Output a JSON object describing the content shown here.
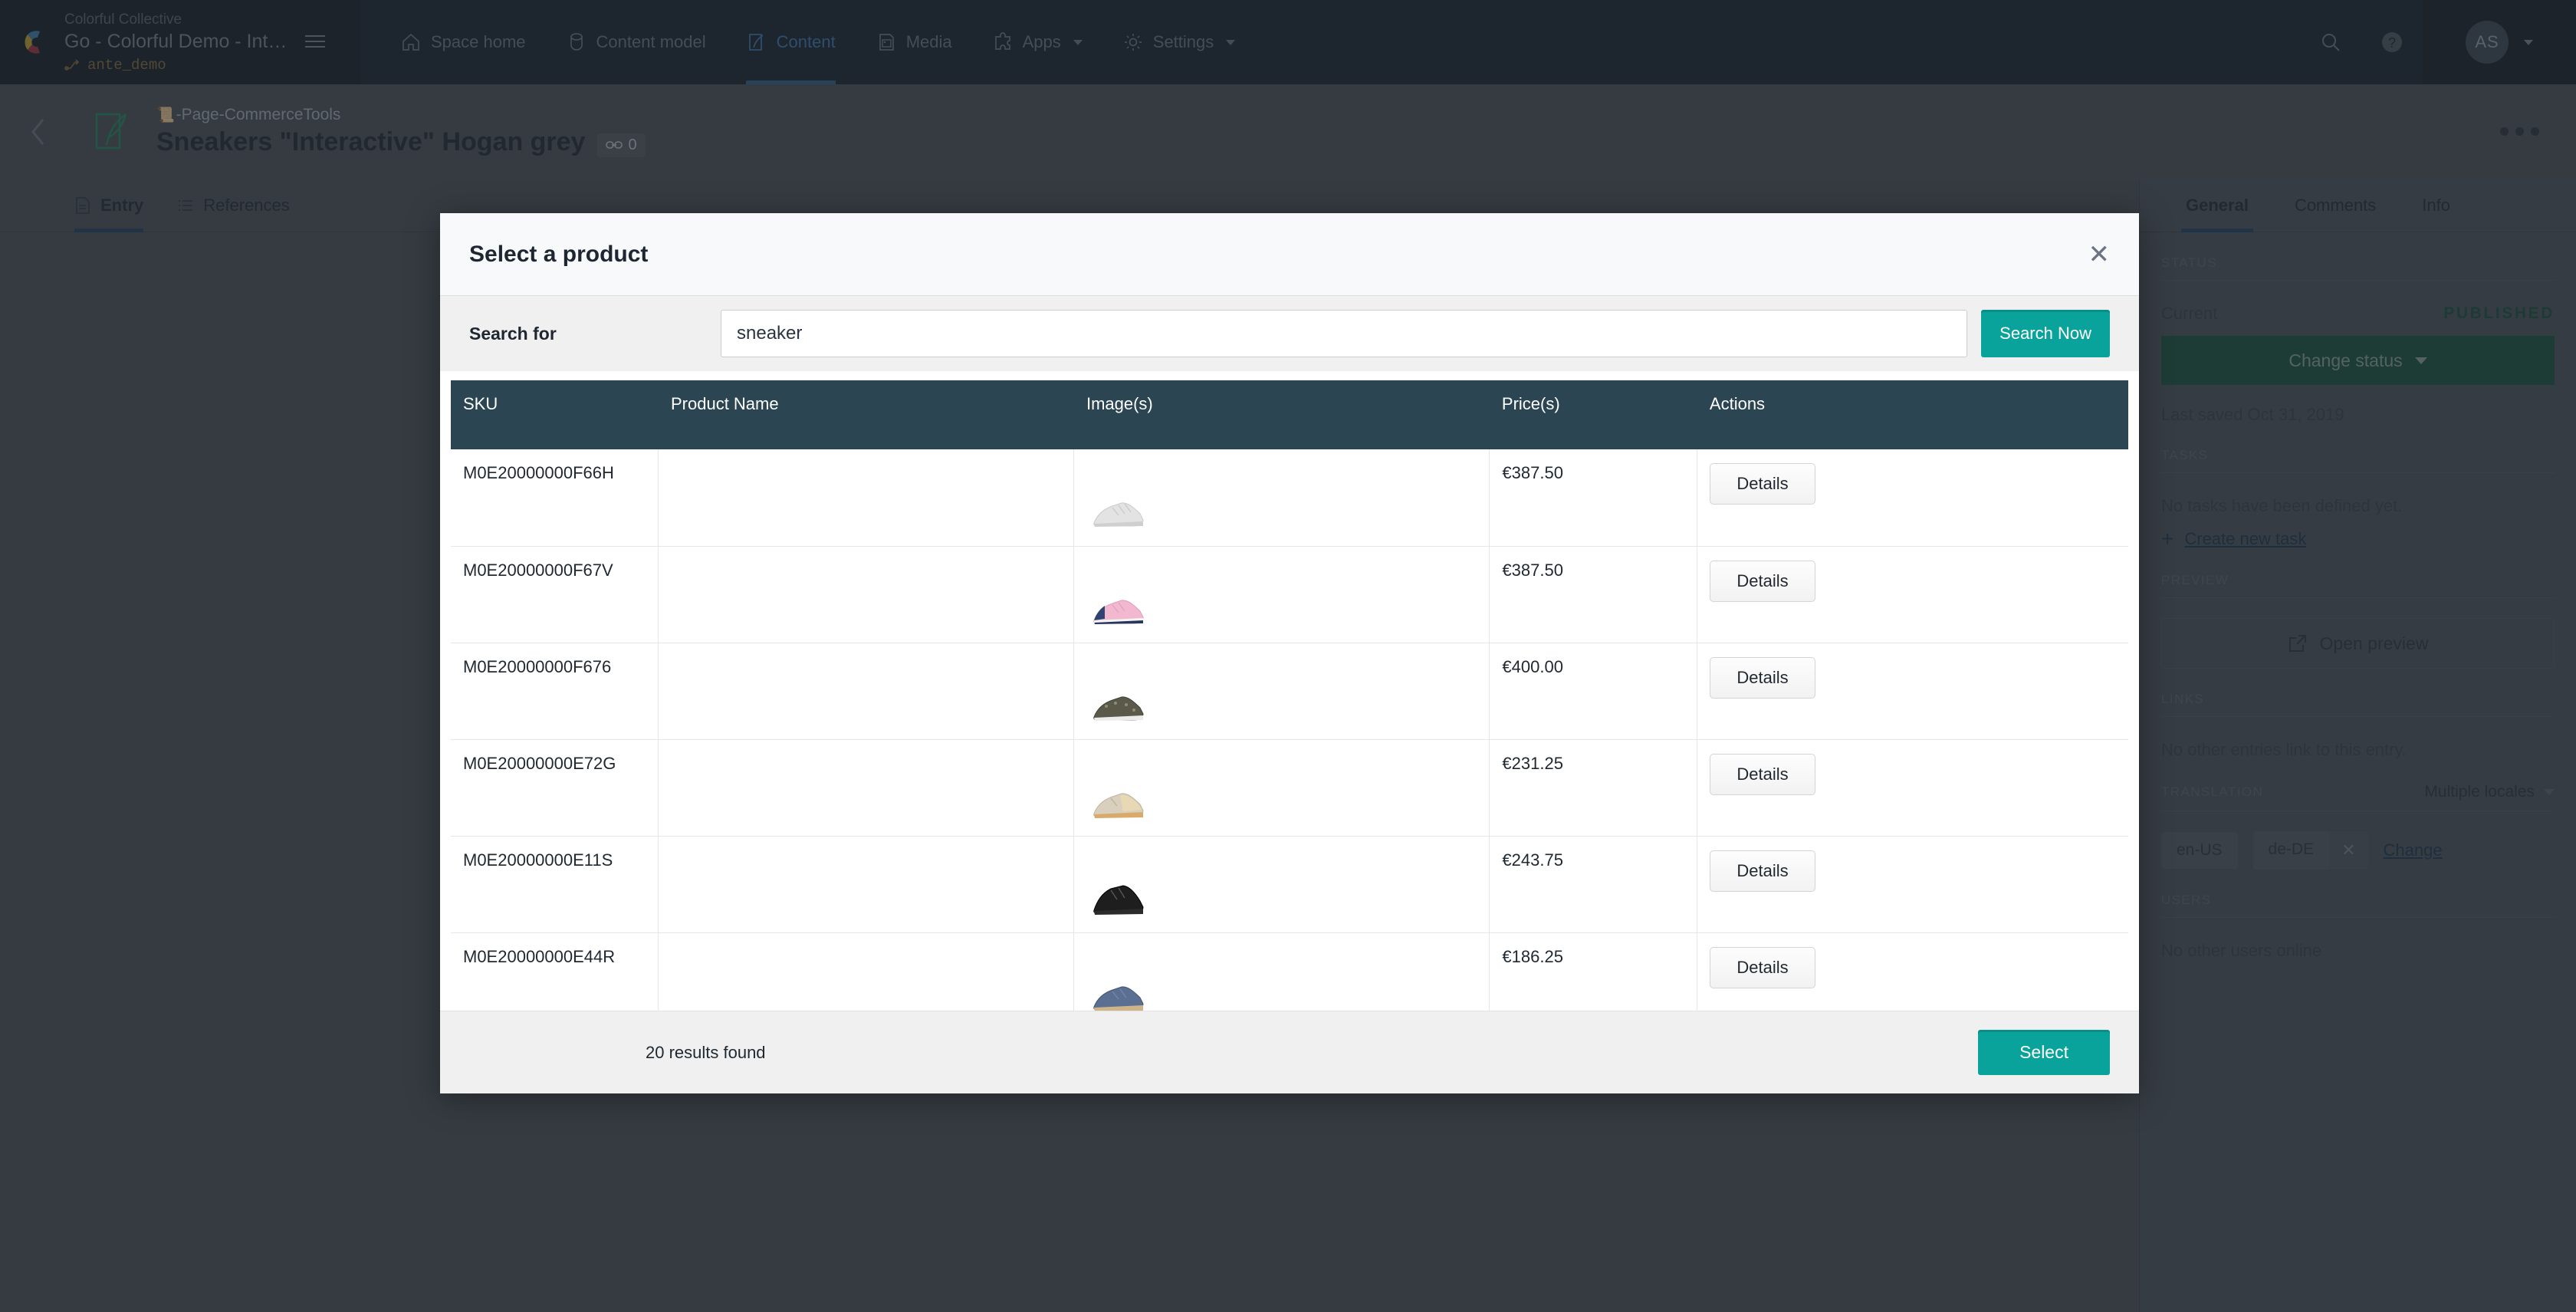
{
  "topnav": {
    "org": "Colorful Collective",
    "space": "Go - Colorful Demo - Inte…",
    "environment": "ante_demo",
    "items": [
      {
        "label": "Space home",
        "icon": "home-icon",
        "active": false,
        "caret": false
      },
      {
        "label": "Content model",
        "icon": "content-model-icon",
        "active": false,
        "caret": false
      },
      {
        "label": "Content",
        "icon": "content-icon",
        "active": true,
        "caret": false
      },
      {
        "label": "Media",
        "icon": "media-icon",
        "active": false,
        "caret": false
      },
      {
        "label": "Apps",
        "icon": "apps-icon",
        "active": false,
        "caret": true
      },
      {
        "label": "Settings",
        "icon": "gear-icon",
        "active": false,
        "caret": true
      }
    ],
    "avatar_initials": "AS",
    "accent_active": "#3d7ab8"
  },
  "entry": {
    "breadcrumb_emoji": "📜",
    "breadcrumb": "-Page-CommerceTools",
    "title": "Sneakers \"Interactive\" Hogan grey",
    "link_count": "0",
    "tabs": [
      {
        "label": "Entry",
        "active": true
      },
      {
        "label": "References",
        "active": false
      }
    ]
  },
  "rail": {
    "tabs": [
      {
        "label": "General",
        "active": true
      },
      {
        "label": "Comments",
        "active": false
      },
      {
        "label": "Info",
        "active": false
      }
    ],
    "status": {
      "heading": "STATUS",
      "current_label": "Current",
      "current_value": "PUBLISHED",
      "change_button": "Change status",
      "last_saved": "Last saved Oct 31, 2019",
      "published_color": "#12503c"
    },
    "tasks": {
      "heading": "TASKS",
      "empty": "No tasks have been defined yet.",
      "create_link": "Create new task"
    },
    "preview": {
      "heading": "PREVIEW",
      "button": "Open preview"
    },
    "links": {
      "heading": "LINKS",
      "empty": "No other entries link to this entry."
    },
    "translation": {
      "heading": "TRANSLATION",
      "selector": "Multiple locales",
      "locales": [
        "en-US",
        "de-DE"
      ],
      "change_link": "Change"
    },
    "users": {
      "heading": "USERS",
      "empty": "No other users online"
    }
  },
  "modal": {
    "title": "Select a product",
    "close_label": "✕",
    "search_label": "Search for",
    "search_value": "sneaker",
    "search_placeholder": "",
    "search_button": "Search Now",
    "columns": [
      "SKU",
      "Product Name",
      "Image(s)",
      "Price(s)",
      "Actions"
    ],
    "rows": [
      {
        "sku": "M0E20000000F66H",
        "name": "",
        "price": "€387.50",
        "action": "Details",
        "thumb": "shoe-white"
      },
      {
        "sku": "M0E20000000F67V",
        "name": "",
        "price": "€387.50",
        "action": "Details",
        "thumb": "shoe-pink"
      },
      {
        "sku": "M0E20000000F676",
        "name": "",
        "price": "€400.00",
        "action": "Details",
        "thumb": "shoe-camo"
      },
      {
        "sku": "M0E20000000E72G",
        "name": "",
        "price": "€231.25",
        "action": "Details",
        "thumb": "shoe-beige"
      },
      {
        "sku": "M0E20000000E11S",
        "name": "",
        "price": "€243.75",
        "action": "Details",
        "thumb": "shoe-black"
      },
      {
        "sku": "M0E20000000E44R",
        "name": "",
        "price": "€186.25",
        "action": "Details",
        "thumb": "shoe-blue"
      }
    ],
    "results_count": "20 results found",
    "select_button": "Select",
    "accent": "#0aa39b",
    "header_bg": "#2b4553"
  }
}
